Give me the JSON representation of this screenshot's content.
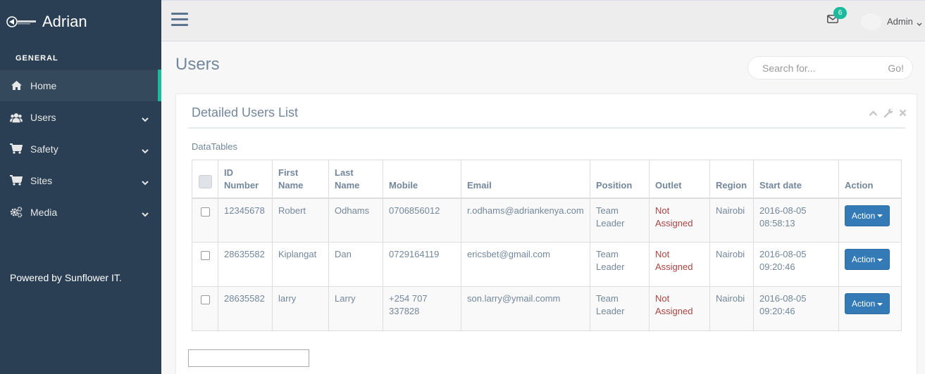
{
  "sidebar": {
    "brand": "Adrian",
    "section_title": "GENERAL",
    "items": [
      {
        "label": "Home",
        "icon": "home-icon"
      },
      {
        "label": "Users",
        "icon": "users-icon"
      },
      {
        "label": "Safety",
        "icon": "cart-icon"
      },
      {
        "label": "Sites",
        "icon": "cart-icon"
      },
      {
        "label": "Media",
        "icon": "cogs-icon"
      }
    ],
    "footer": "Powered by Sunflower IT."
  },
  "topnav": {
    "mail_badge": "6",
    "user_name": "Admin"
  },
  "page": {
    "title": "Users",
    "search_placeholder": "Search for...",
    "search_button": "Go!"
  },
  "panel": {
    "title": "Detailed Users List",
    "subtitle": "DataTables",
    "columns": [
      "ID Number",
      "First Name",
      "Last Name",
      "Mobile",
      "Email",
      "Position",
      "Outlet",
      "Region",
      "Start date",
      "Action"
    ],
    "rows": [
      {
        "id": "12345678",
        "first": "Robert",
        "last": "Odhams",
        "mobile": "0706856012",
        "email": "r.odhams@adriankenya.com",
        "position": "Team Leader",
        "outlet": "Not Assigned",
        "region": "Nairobi",
        "start": "2016-08-05 08:58:13",
        "action": "Action"
      },
      {
        "id": "28635582",
        "first": "Kiplangat",
        "last": "Dan",
        "mobile": "0729164119",
        "email": "ericsbet@gmail.com",
        "position": "Team Leader",
        "outlet": "Not Assigned",
        "region": "Nairobi",
        "start": "2016-08-05 09:20:46",
        "action": "Action"
      },
      {
        "id": "28635582",
        "first": "larry",
        "last": "Larry",
        "mobile": "+254 707 337828",
        "email": "son.larry@ymail.comm",
        "position": "Team Leader",
        "outlet": "Not Assigned",
        "region": "Nairobi",
        "start": "2016-08-05 09:20:46",
        "action": "Action"
      }
    ]
  },
  "colors": {
    "sidebar_bg": "#2a3f54",
    "accent": "#1abb9c",
    "action_button": "#337ab7",
    "not_assigned": "#a94442"
  }
}
